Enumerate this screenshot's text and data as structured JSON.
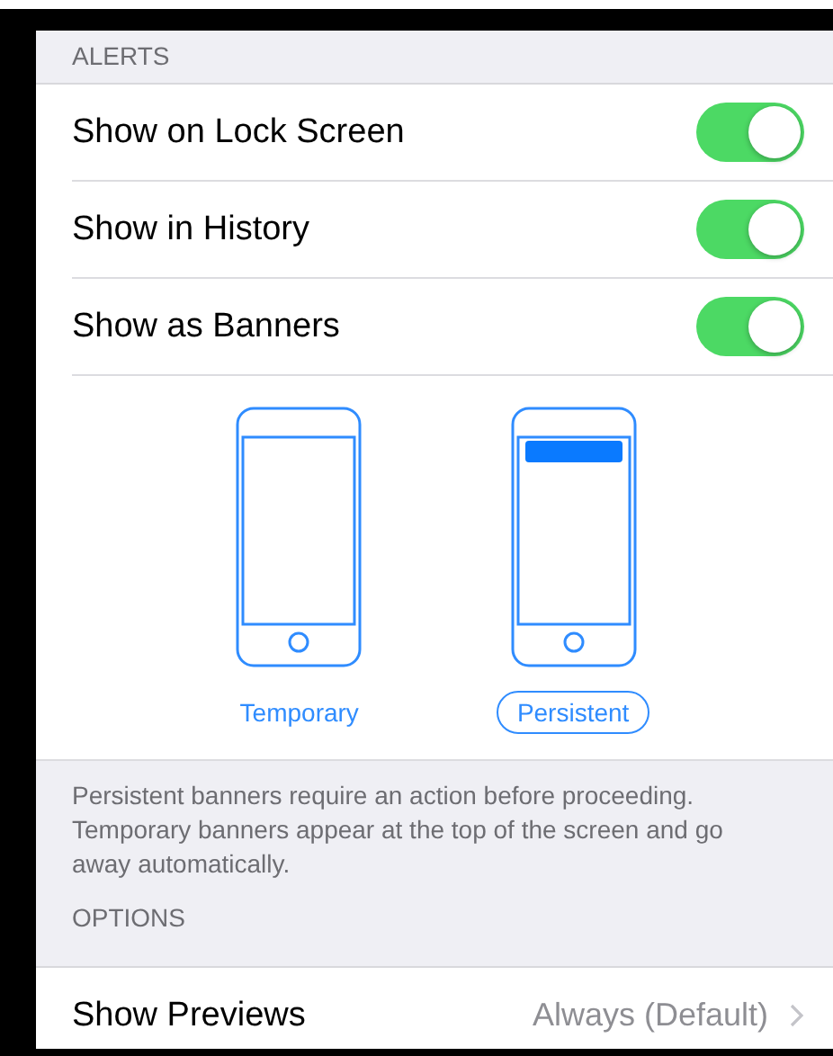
{
  "sections": [
    {
      "header": "ALERTS",
      "toggles": [
        {
          "label": "Show on Lock Screen",
          "on": true
        },
        {
          "label": "Show in History",
          "on": true
        },
        {
          "label": "Show as Banners",
          "on": true
        }
      ],
      "banner_styles": [
        {
          "label": "Temporary",
          "kind": "temporary",
          "selected": false
        },
        {
          "label": "Persistent",
          "kind": "persistent",
          "selected": true
        }
      ],
      "footer": "Persistent banners require an action before proceeding. Temporary banners appear at the top of the screen and go away automatically."
    },
    {
      "header": "OPTIONS",
      "rows": [
        {
          "label": "Show Previews",
          "value": "Always (Default)"
        }
      ]
    }
  ]
}
